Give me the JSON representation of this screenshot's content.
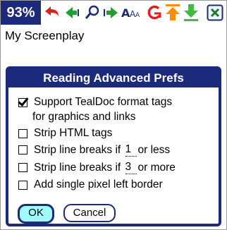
{
  "status": {
    "battery": "93%"
  },
  "toolbar": {
    "icons": [
      {
        "name": "back-arrow-icon",
        "color": "#e02020"
      },
      {
        "name": "prev-arrow-icon",
        "color": "#1f9f2f"
      },
      {
        "name": "search-icon",
        "color": "#1c2a7c"
      },
      {
        "name": "next-arrow-icon",
        "color": "#1f9f2f"
      },
      {
        "name": "font-size-icon",
        "color": "#1c2a7c"
      },
      {
        "name": "go-to-icon",
        "color": "#e02020"
      },
      {
        "name": "top-jump-icon",
        "color": "#ff8f00"
      },
      {
        "name": "bottom-jump-icon",
        "color": "#3dbd3d"
      },
      {
        "name": "close-icon",
        "color": "#1c2a7c"
      }
    ]
  },
  "doc": {
    "title": "My Screenplay"
  },
  "dialog": {
    "title": "Reading Advanced Prefs",
    "options": [
      {
        "label": "Support TealDoc format tags",
        "label2": "for graphics and links",
        "checked": true
      },
      {
        "label": "Strip HTML tags",
        "checked": false
      },
      {
        "label_pre": "Strip line breaks if",
        "value": "1",
        "label_post": "or less",
        "checked": false
      },
      {
        "label_pre": "Strip line breaks if",
        "value": "3",
        "label_post": "or more",
        "checked": false
      },
      {
        "label": "Add single pixel left border",
        "checked": false
      }
    ],
    "ok_label": "OK",
    "cancel_label": "Cancel"
  },
  "colors": {
    "accent": "#1c2a7c",
    "ok_fill": "#9ffbff"
  }
}
